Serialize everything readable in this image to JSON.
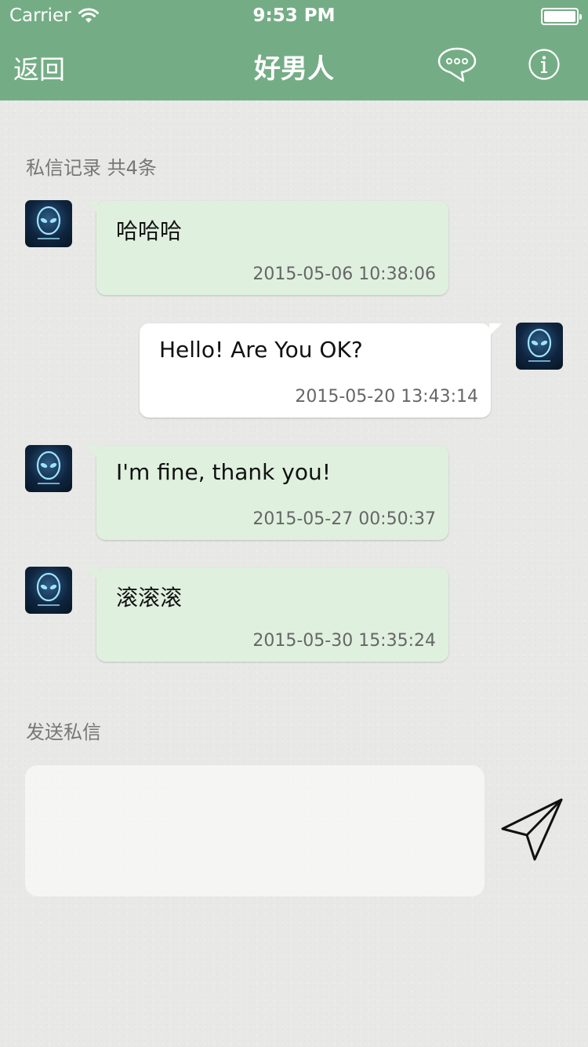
{
  "status_bar": {
    "carrier": "Carrier",
    "time": "9:53 PM",
    "wifi_icon": "wifi-icon",
    "battery_icon": "battery-icon"
  },
  "nav": {
    "back_label": "返回",
    "title": "好男人",
    "chat_icon": "chat-bubble-icon",
    "info_icon": "info-icon",
    "bar_color": "#74ad85"
  },
  "history": {
    "label": "私信记录 共4条",
    "messages": [
      {
        "direction": "incoming",
        "text": "哈哈哈",
        "timestamp": "2015-05-06 10:38:06"
      },
      {
        "direction": "outgoing",
        "text": "Hello! Are You OK?",
        "timestamp": "2015-05-20 13:43:14"
      },
      {
        "direction": "incoming",
        "text": "I'm fine, thank you!",
        "timestamp": "2015-05-27 00:50:37"
      },
      {
        "direction": "incoming",
        "text": "滚滚滚",
        "timestamp": "2015-05-30 15:35:24"
      }
    ]
  },
  "compose": {
    "label": "发送私信",
    "value": "",
    "send_icon": "paper-plane-icon"
  }
}
